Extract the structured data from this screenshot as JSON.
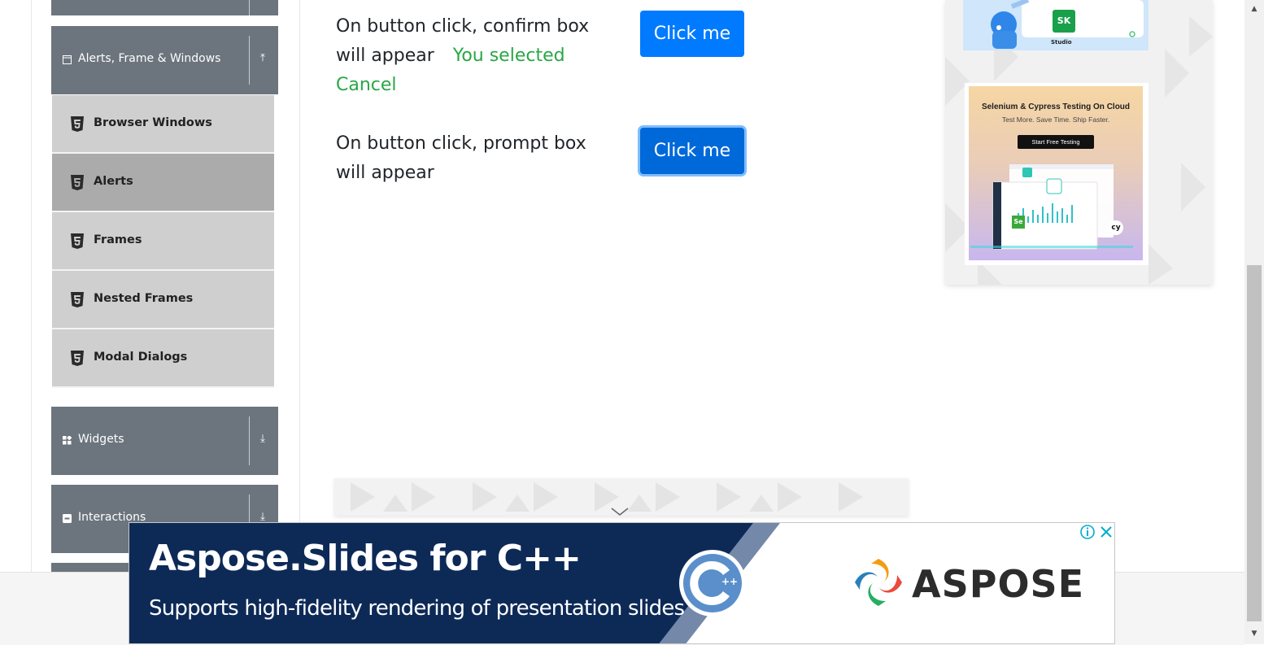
{
  "sidebar": {
    "alerts_group": {
      "label": "Alerts, Frame & Windows",
      "arrow": "⤒"
    },
    "items": [
      {
        "label": "Browser Windows",
        "active": false
      },
      {
        "label": "Alerts",
        "active": true
      },
      {
        "label": "Frames",
        "active": false
      },
      {
        "label": "Nested Frames",
        "active": false
      },
      {
        "label": "Modal Dialogs",
        "active": false
      }
    ],
    "widgets_group": {
      "label": "Widgets",
      "arrow": "⤓"
    },
    "interactions_group": {
      "label": "Interactions",
      "arrow": "⤓"
    }
  },
  "main": {
    "confirm": {
      "line1": "On button click, confirm box",
      "line2": "will appear",
      "result_prefix": "You selected",
      "result_value": "Cancel",
      "button_label": "Click me"
    },
    "prompt": {
      "line1": "On button click, prompt box",
      "line2": "will appear",
      "button_label": "Click me"
    }
  },
  "right_ad": {
    "top_card_label": "Studio",
    "top_card_badge": "SK",
    "card_title": "Selenium & Cypress Testing On Cloud",
    "card_subtitle": "Test More. Save Time. Ship Faster.",
    "card_button": "Start Free Testing",
    "card_badge_se": "Se",
    "card_badge_cy": "cy"
  },
  "bottom_ad": {
    "title": "Aspose.Slides for C++",
    "subtitle": "Supports high-fidelity rendering of presentation slides",
    "brand": "ASPOSE",
    "logo_text": "++"
  },
  "colors": {
    "primary_button": "#007bff",
    "success_text": "#28a745",
    "sidebar_header": "#6c757d",
    "ad_navy": "#0d2a57"
  }
}
